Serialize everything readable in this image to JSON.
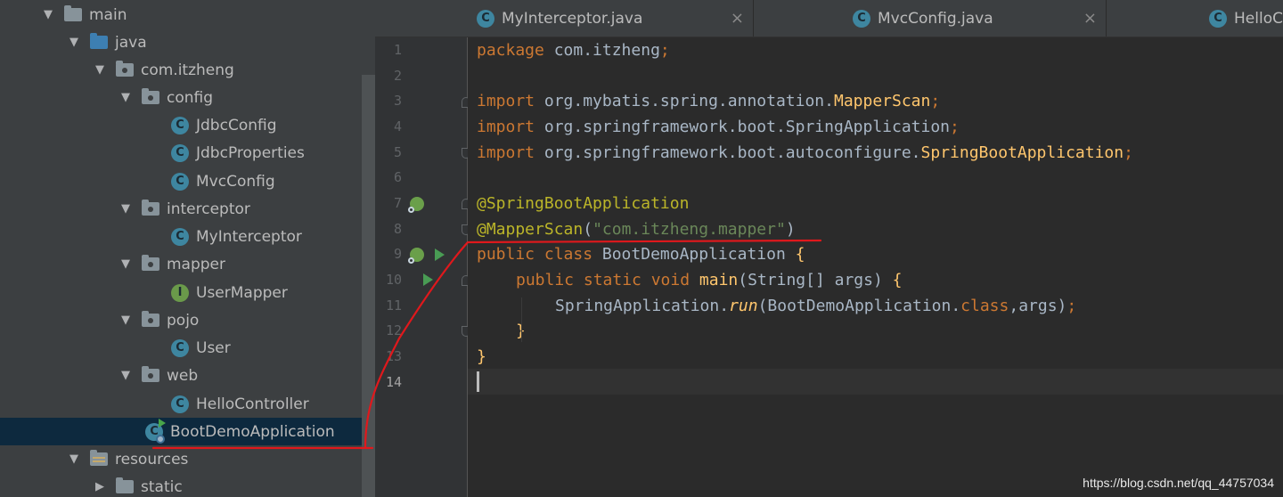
{
  "project_tree": {
    "items": [
      {
        "label": "main",
        "icon": "folder-icon"
      },
      {
        "label": "java",
        "icon": "source-folder-icon"
      },
      {
        "label": "com.itzheng",
        "icon": "package-icon"
      },
      {
        "label": "config",
        "icon": "package-icon"
      },
      {
        "label": "JdbcConfig",
        "icon": "class-icon",
        "glyph": "C"
      },
      {
        "label": "JdbcProperties",
        "icon": "class-icon",
        "glyph": "C"
      },
      {
        "label": "MvcConfig",
        "icon": "class-icon",
        "glyph": "C"
      },
      {
        "label": "interceptor",
        "icon": "package-icon"
      },
      {
        "label": "MyInterceptor",
        "icon": "class-icon",
        "glyph": "C"
      },
      {
        "label": "mapper",
        "icon": "package-icon"
      },
      {
        "label": "UserMapper",
        "icon": "interface-icon",
        "glyph": "I"
      },
      {
        "label": "pojo",
        "icon": "package-icon"
      },
      {
        "label": "User",
        "icon": "class-icon",
        "glyph": "C"
      },
      {
        "label": "web",
        "icon": "package-icon"
      },
      {
        "label": "HelloController",
        "icon": "class-icon",
        "glyph": "C"
      },
      {
        "label": "BootDemoApplication",
        "icon": "spring-boot-class-icon",
        "glyph": "C",
        "selected": true
      },
      {
        "label": "resources",
        "icon": "resources-folder-icon"
      },
      {
        "label": "static",
        "icon": "folder-icon"
      }
    ]
  },
  "tabs": [
    {
      "label": "MyInterceptor.java",
      "icon": "class-icon",
      "glyph": "C",
      "close": "×"
    },
    {
      "label": "MvcConfig.java",
      "icon": "class-icon",
      "glyph": "C",
      "close": "×"
    },
    {
      "label": "HelloC",
      "icon": "class-icon",
      "glyph": "C"
    }
  ],
  "editor": {
    "line_numbers": [
      "1",
      "2",
      "3",
      "4",
      "5",
      "6",
      "7",
      "8",
      "9",
      "10",
      "11",
      "12",
      "13",
      "14"
    ],
    "current_line": 14,
    "code": {
      "l1_kw": "package",
      "l1_rest": " com.itzheng",
      "l1_semi": ";",
      "l3_kw": "import",
      "l3_rest": " org.mybatis.spring.annotation.",
      "l3_cls": "MapperScan",
      "l3_semi": ";",
      "l4_kw": "import",
      "l4_rest": " org.springframework.boot.SpringApplication",
      "l4_semi": ";",
      "l5_kw": "import",
      "l5_rest": " org.springframework.boot.autoconfigure.",
      "l5_cls": "SpringBootApplication",
      "l5_semi": ";",
      "l7_ann": "@SpringBootApplication",
      "l8_ann": "@MapperScan",
      "l8_open": "(",
      "l8_str": "\"com.itzheng.mapper\"",
      "l8_close": ")",
      "l9_kw": "public class",
      "l9_rest": " BootDemoApplication ",
      "l9_brace": "{",
      "l10_kw": "public static void",
      "l10_fn": " main",
      "l10_rest": "(String[] args) ",
      "l10_brace": "{",
      "l11_a": "SpringApplication.",
      "l11_fn": "run",
      "l11_b": "(BootDemoApplication.",
      "l11_kw": "class",
      "l11_c": ",args)",
      "l11_semi": ";",
      "l12_brace": "}",
      "l13_brace": "}"
    }
  },
  "watermark": "https://blog.csdn.net/qq_44757034",
  "colors": {
    "keyword": "#cc7832",
    "annotation": "#bbb529",
    "string": "#6a8759",
    "method": "#ffc66d",
    "text": "#a9b7c6",
    "selection": "#0d293e",
    "red_annotation_stroke": "#e0181c"
  }
}
